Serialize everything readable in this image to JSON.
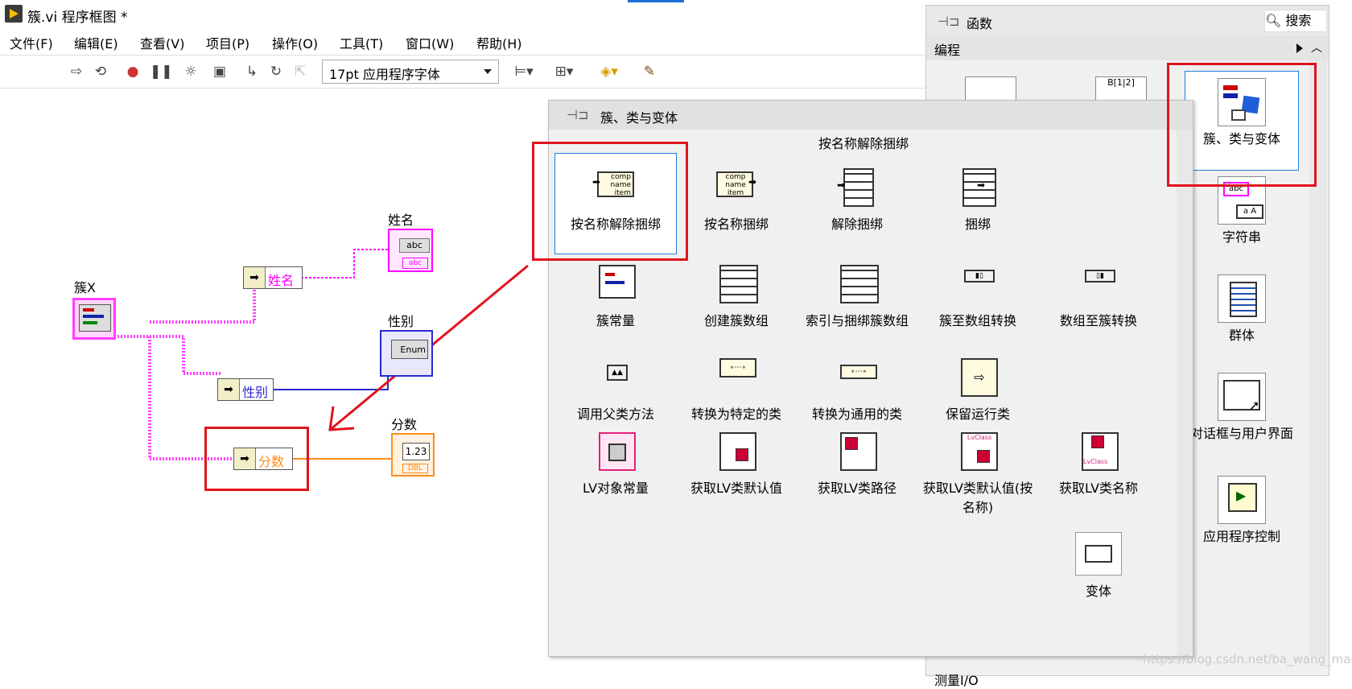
{
  "window": {
    "title": "簇.vi 程序框图 *"
  },
  "menu": [
    "文件(F)",
    "编辑(E)",
    "查看(V)",
    "项目(P)",
    "操作(O)",
    "工具(T)",
    "窗口(W)",
    "帮助(H)"
  ],
  "toolbar": {
    "font_select": "17pt 应用程序字体",
    "icons": [
      "run-arrow-icon",
      "run-continuously-icon",
      "abort-icon",
      "pause-icon",
      "highlight-execution-icon",
      "retain-wire-values-icon",
      "step-into-icon",
      "step-over-icon",
      "step-out-icon",
      "align-objects-icon",
      "distribute-objects-icon",
      "reorder-icon",
      "cleanup-diagram-icon"
    ]
  },
  "diagram": {
    "cluster_label": "簇X",
    "name_indicator_label": "姓名",
    "gender_indicator_label": "性别",
    "score_indicator_label": "分数",
    "unbundle_name": "姓名",
    "unbundle_gender": "性别",
    "unbundle_score": "分数",
    "name_terminal_text": "abc",
    "name_terminal_type": "abc",
    "gender_terminal_text": "Enum",
    "score_terminal_text": "1.23",
    "score_terminal_type": "DBL",
    "colors": {
      "string_wire": "#ff00ff",
      "enum_wire": "#2a2ad0",
      "dbl_wire": "#ff8c1a",
      "cluster_wire": "#ff3fff",
      "annotation": "#e0141d"
    }
  },
  "functions_palette": {
    "title": "函数",
    "search": "搜索",
    "category": "编程",
    "items": [
      "簇、类与变体",
      "字符串",
      "群体",
      "对话框与用户界面",
      "应用程序控制"
    ],
    "bottom_label": "测量I/O"
  },
  "cluster_palette": {
    "title": "簇、类与变体",
    "tooltip": "按名称解除捆绑",
    "items": [
      {
        "label": "按名称解除捆绑",
        "icon": "unbundle-by-name-icon"
      },
      {
        "label": "按名称捆绑",
        "icon": "bundle-by-name-icon"
      },
      {
        "label": "解除捆绑",
        "icon": "unbundle-icon"
      },
      {
        "label": "捆绑",
        "icon": "bundle-icon"
      },
      {
        "label": "簇常量",
        "icon": "cluster-constant-icon"
      },
      {
        "label": "创建簇数组",
        "icon": "build-cluster-array-icon"
      },
      {
        "label": "索引与捆绑簇数组",
        "icon": "index-bundle-cluster-array-icon"
      },
      {
        "label": "簇至数组转换",
        "icon": "cluster-to-array-icon"
      },
      {
        "label": "数组至簇转换",
        "icon": "array-to-cluster-icon"
      },
      {
        "label": "调用父类方法",
        "icon": "call-parent-method-icon"
      },
      {
        "label": "转换为特定的类",
        "icon": "to-more-specific-class-icon"
      },
      {
        "label": "转换为通用的类",
        "icon": "to-more-generic-class-icon"
      },
      {
        "label": "保留运行类",
        "icon": "preserve-runtime-class-icon"
      },
      {
        "label": "LV对象常量",
        "icon": "lv-object-constant-icon"
      },
      {
        "label": "获取LV类默认值",
        "icon": "get-lv-class-default-value-icon"
      },
      {
        "label": "获取LV类路径",
        "icon": "get-lv-class-path-icon"
      },
      {
        "label": "获取LV类默认值(按名称)",
        "icon": "get-lv-class-default-value-by-name-icon"
      },
      {
        "label": "获取LV类名称",
        "icon": "get-lv-class-name-icon"
      },
      {
        "label": "变体",
        "icon": "variant-icon"
      }
    ]
  },
  "watermark": "https://blog.csdn.net/ba_wang_mao"
}
